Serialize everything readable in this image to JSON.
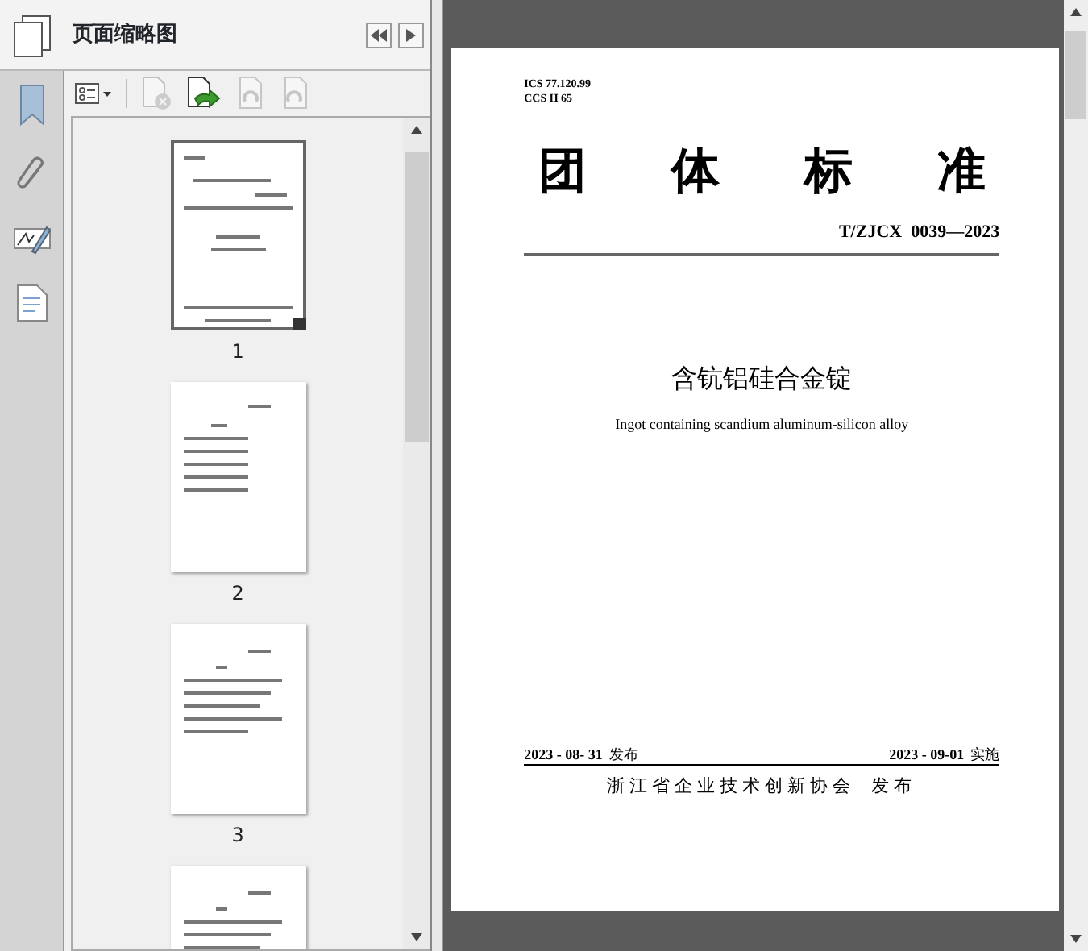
{
  "panel": {
    "title": "页面缩略图"
  },
  "toolbar": [
    {
      "kind": "options",
      "disabled": false
    },
    {
      "kind": "delete",
      "disabled": true
    },
    {
      "kind": "insert",
      "disabled": false
    },
    {
      "kind": "undo",
      "disabled": true
    },
    {
      "kind": "redo",
      "disabled": true
    }
  ],
  "thumbnails": [
    {
      "page_number": "1",
      "selected": true,
      "kind": "cover"
    },
    {
      "page_number": "2",
      "selected": false,
      "kind": "contents"
    },
    {
      "page_number": "3",
      "selected": false,
      "kind": "text"
    },
    {
      "selected": false,
      "kind": "text"
    }
  ],
  "document": {
    "ics": "ICS 77.120.99",
    "ccs": "CCS H 65",
    "heading": "团 体 标 准",
    "code": "T/ZJCX  0039—2023",
    "title_zh": "含钪铝硅合金锭",
    "title_en": "Ingot containing scandium aluminum-silicon alloy",
    "publish_date": "2023 - 08- 31",
    "publish_label": "发布",
    "effective_date": "2023 - 09-01",
    "effective_label": "实施",
    "publisher": "浙江省企业技术创新协会",
    "publisher_action": "发布"
  }
}
